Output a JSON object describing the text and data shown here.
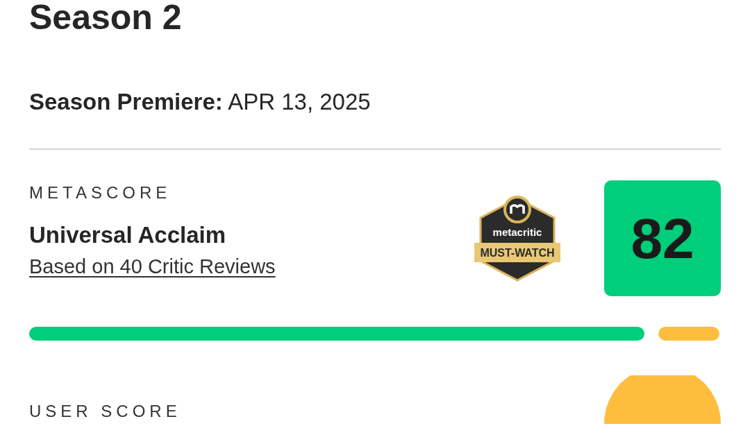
{
  "title": "Season 2",
  "premiere": {
    "label": "Season Premiere:",
    "date": "APR 13, 2025"
  },
  "metascore": {
    "label": "METASCORE",
    "verdict": "Universal Acclaim",
    "reviews_link": "Based on 40 Critic Reviews",
    "badge": {
      "brand": "metacritic",
      "award": "MUST-WATCH"
    },
    "score": "82",
    "distribution": [
      {
        "color": "#00ce7a"
      },
      {
        "color": "#ffbd3f"
      }
    ]
  },
  "user_score": {
    "label": "USER SCORE"
  }
}
